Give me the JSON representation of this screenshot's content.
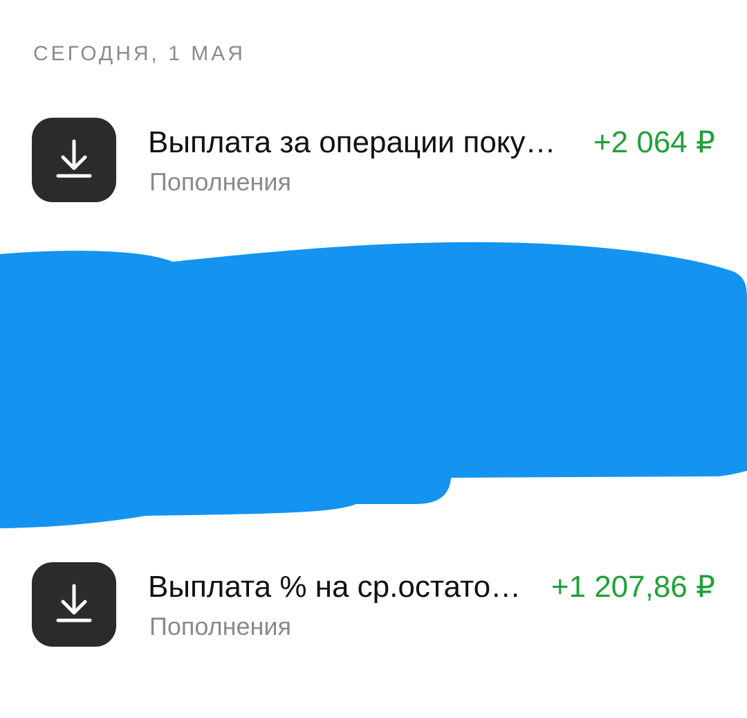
{
  "date_header": "СЕГОДНЯ, 1 МАЯ",
  "transactions": [
    {
      "title": "Выплата за операции поку…",
      "category": "Пополнения",
      "amount": "+2 064 ₽",
      "icon": "download-icon"
    },
    {
      "title": "Выплата % на ср.остато…",
      "category": "Пополнения",
      "amount": "+1 207,86 ₽",
      "icon": "download-icon"
    }
  ],
  "colors": {
    "amount_positive": "#21a038",
    "icon_background": "#2b2b2d",
    "redaction": "#1493f0",
    "secondary_text": "#8a8a8e"
  }
}
